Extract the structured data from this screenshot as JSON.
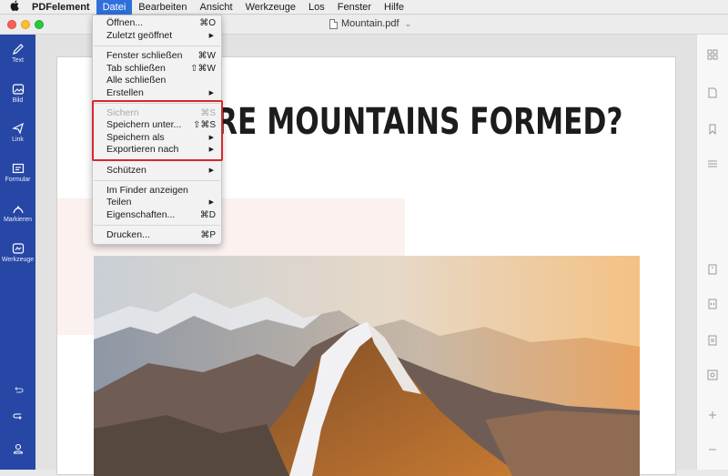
{
  "menubar": {
    "app_name": "PDFelement",
    "items": [
      "Datei",
      "Bearbeiten",
      "Ansicht",
      "Werkzeuge",
      "Los",
      "Fenster",
      "Hilfe"
    ]
  },
  "window": {
    "document_title": "Mountain.pdf"
  },
  "sidebar": {
    "items": [
      {
        "label": "Text",
        "icon": "pen-icon"
      },
      {
        "label": "Bild",
        "icon": "image-icon"
      },
      {
        "label": "Link",
        "icon": "link-icon"
      },
      {
        "label": "Formular",
        "icon": "form-icon"
      },
      {
        "label": "Markieren",
        "icon": "highlighter-icon"
      },
      {
        "label": "Werkzeuge",
        "icon": "tools-icon"
      }
    ],
    "bottom_icons": [
      "undo-icon",
      "redo-icon",
      "user-icon"
    ]
  },
  "file_menu": {
    "items": [
      {
        "label": "Öffnen...",
        "shortcut": "⌘O"
      },
      {
        "label": "Zuletzt geöffnet",
        "submenu": "▶"
      },
      {
        "label": "Fenster schließen",
        "shortcut": "⌘W"
      },
      {
        "label": "Tab schließen",
        "shortcut": "⇧⌘W"
      },
      {
        "label": "Alle schließen"
      },
      {
        "label": "Erstellen",
        "submenu": "▶"
      },
      {
        "label": "Sichern",
        "shortcut": "⌘S",
        "disabled": true
      },
      {
        "label": "Speichern unter...",
        "shortcut": "⇧⌘S"
      },
      {
        "label": "Speichern als",
        "submenu": "▶"
      },
      {
        "label": "Exportieren nach",
        "submenu": "▶"
      },
      {
        "label": "Schützen",
        "submenu": "▶"
      },
      {
        "label": "Im Finder anzeigen"
      },
      {
        "label": "Teilen",
        "submenu": "▶"
      },
      {
        "label": "Eigenschaften...",
        "shortcut": "⌘D"
      },
      {
        "label": "Drucken...",
        "shortcut": "⌘P"
      }
    ]
  },
  "document": {
    "headline": "RE MOUNTAINS FORMED?"
  },
  "colors": {
    "accent": "#2f6fd9",
    "sidebar": "#2747a6",
    "highlight_border": "#d8272d"
  }
}
